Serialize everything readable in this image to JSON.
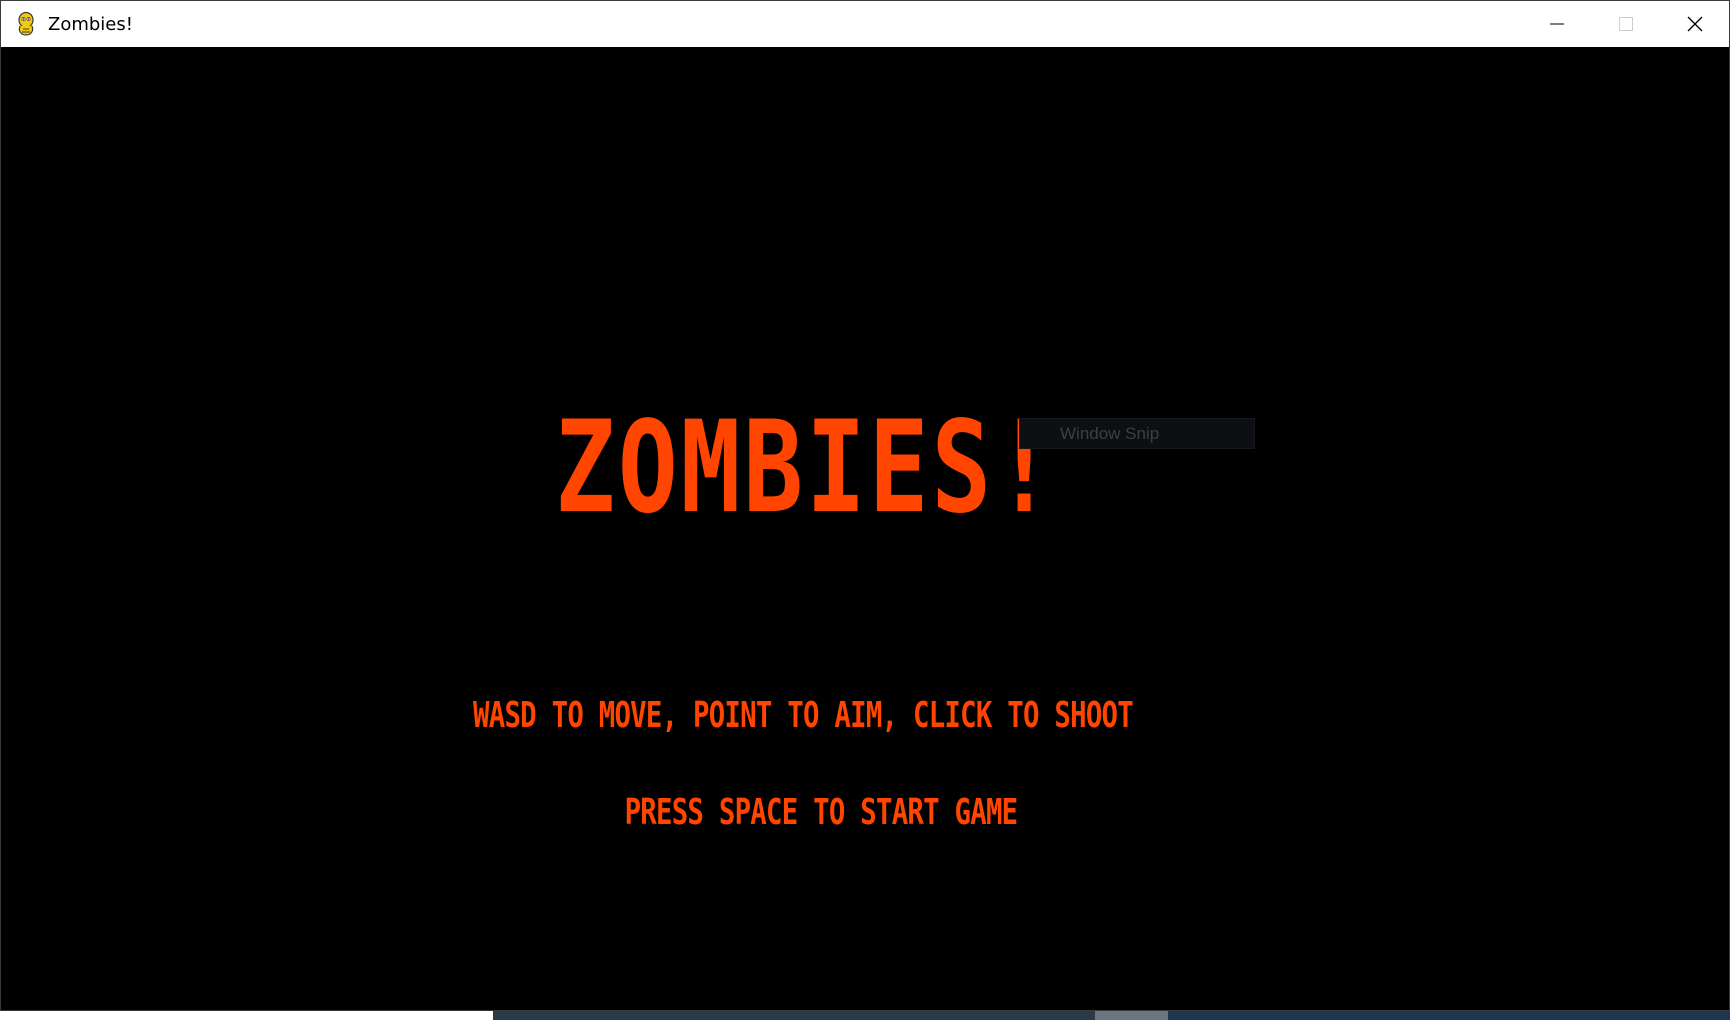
{
  "window": {
    "title": "Zombies!",
    "app_icon": "pygame-snake-icon",
    "controls": {
      "minimize_icon": "minimize-icon",
      "maximize_icon": "maximize-icon",
      "close_icon": "close-icon"
    }
  },
  "game": {
    "title": "ZOMBIES!",
    "instructions": "WASD TO MOVE, POINT TO AIM, CLICK TO SHOOT",
    "start_prompt": "PRESS SPACE TO START GAME",
    "text_color": "#ff4500",
    "background_color": "#000000"
  },
  "tooltip": {
    "label": "Window Snip"
  }
}
